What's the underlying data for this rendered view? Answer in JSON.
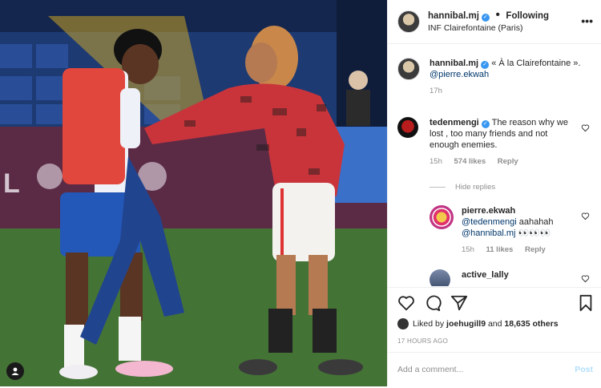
{
  "header": {
    "username": "hannibal.mj",
    "separator": "•",
    "follow_label": "Following",
    "location": "INF Clairefontaine (Paris)",
    "more_label": "•••"
  },
  "caption": {
    "username": "hannibal.mj",
    "text": "« À la Clairefontaine ».",
    "mention": "@pierre.ekwah",
    "time": "17h"
  },
  "comments": [
    {
      "username": "tedenmengi",
      "text": "The reason why we lost , too many friends and not enough enemies.",
      "time": "15h",
      "likes": "574 likes",
      "reply_label": "Reply"
    }
  ],
  "hide_replies_label": "Hide replies",
  "replies": [
    {
      "username": "pierre.ekwah",
      "mention1": "@tedenmengi",
      "text": "aahahah",
      "mention2": "@hannibal.mj",
      "emoji": "👀👀👀",
      "time": "15h",
      "likes": "11 likes",
      "reply_label": "Reply"
    },
    {
      "username": "active_lally"
    }
  ],
  "likes": {
    "prefix": "Liked by",
    "user": "joehugill9",
    "middle": "and",
    "others": "18,635 others"
  },
  "timestamp": "17 HOURS AGO",
  "add_comment": {
    "placeholder": "Add a comment...",
    "post_label": "Post"
  },
  "colors": {
    "verified": "#3897f0",
    "mention": "#00376b",
    "post_disabled": "#b2dffc"
  }
}
